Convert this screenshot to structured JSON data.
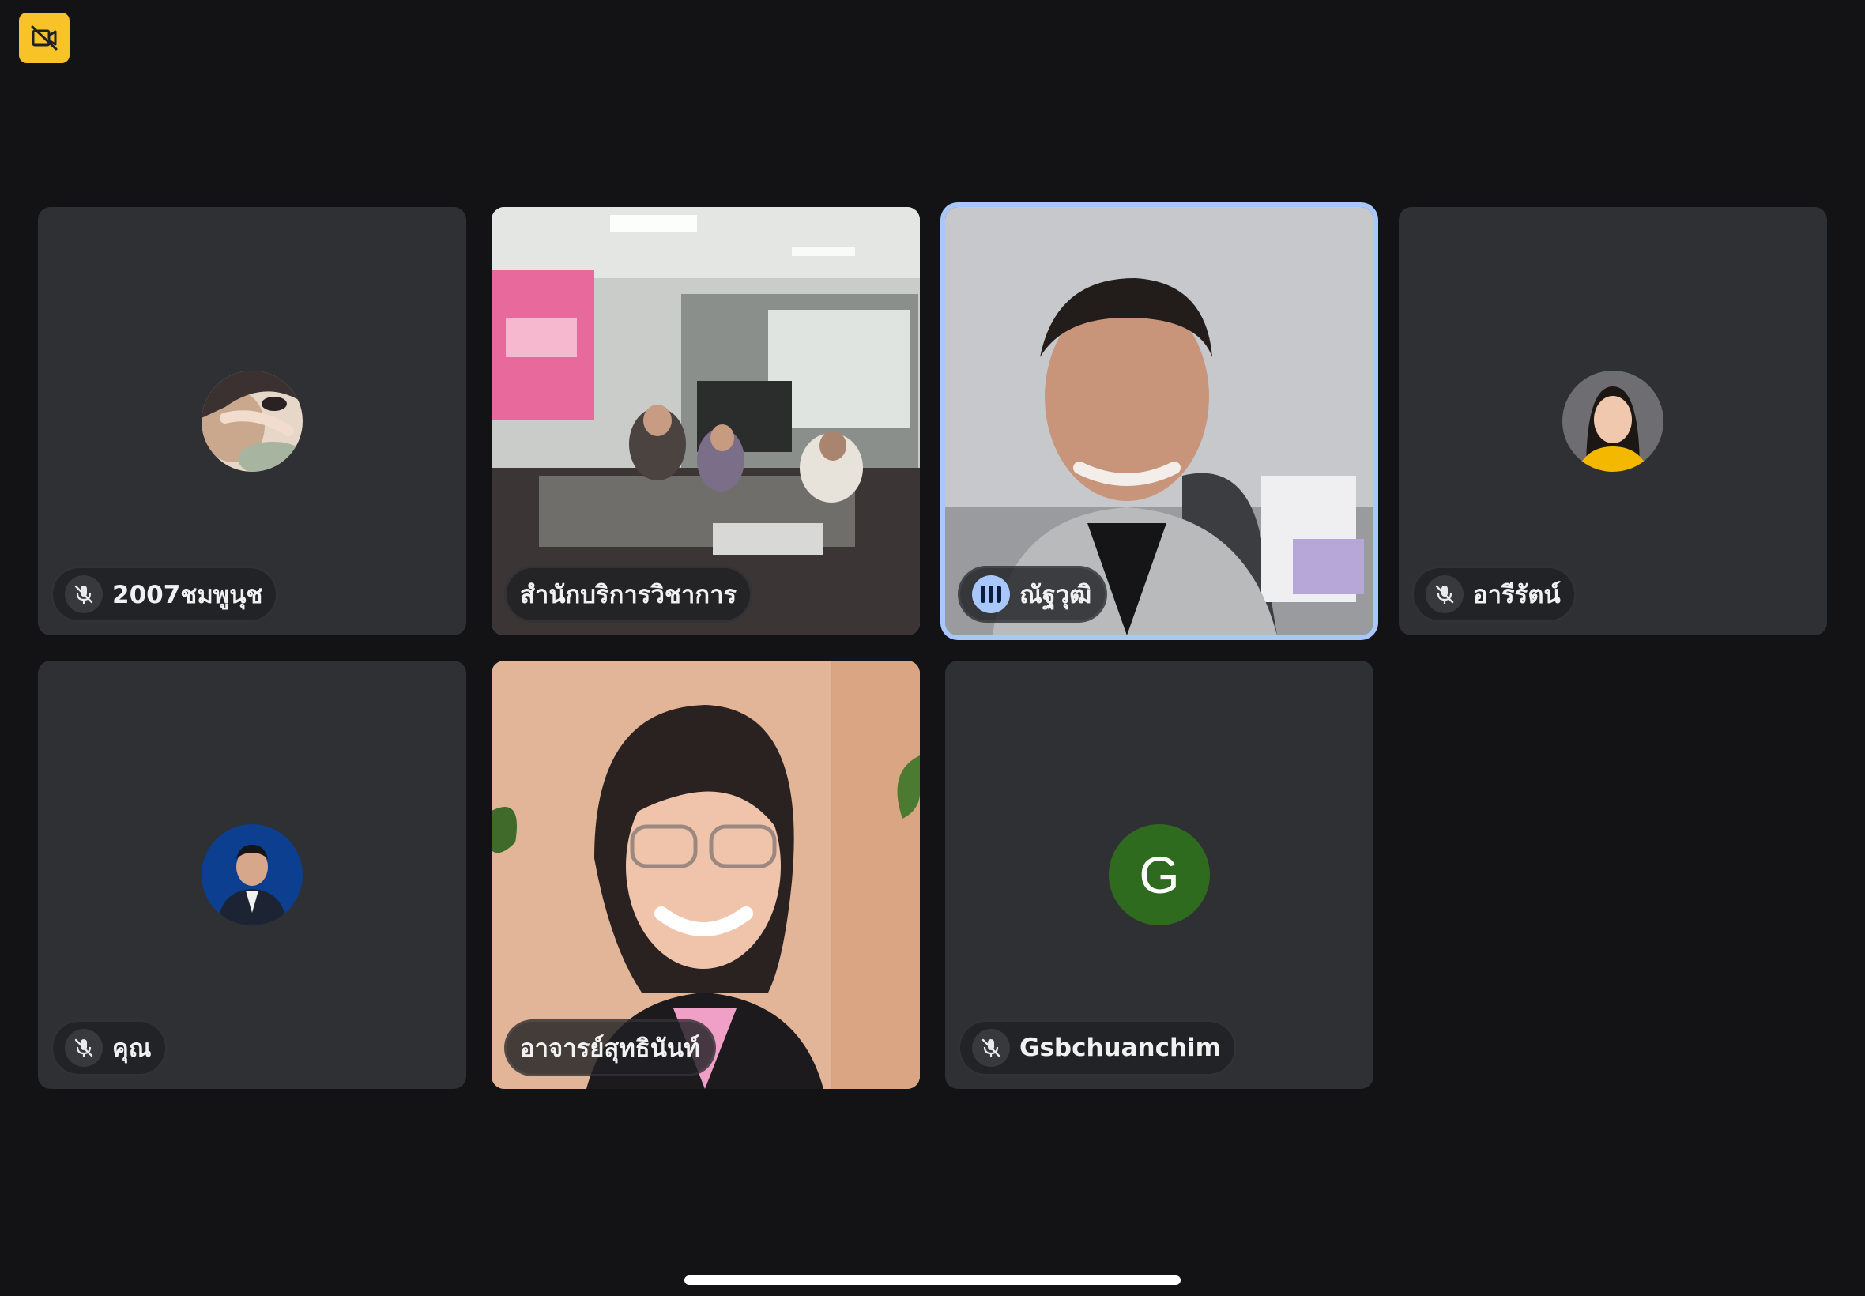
{
  "toolbar": {
    "camera_off_icon": "video-off-icon",
    "camera_off_color": "#f7c328"
  },
  "participants": [
    {
      "name": "2007ชมพูนุช",
      "muted": true,
      "avatar": "photo"
    },
    {
      "name": "สำนักบริการวิชาการ",
      "video": "meeting-room"
    },
    {
      "name": "ณัฐวุฒิ",
      "speaking": true,
      "video": "man-smiling"
    },
    {
      "name": "อารีรัตน์",
      "muted": true,
      "avatar": "photo"
    },
    {
      "name": "คุณ",
      "muted": true,
      "avatar": "photo"
    },
    {
      "name": "อาจารย์สุทธินันท์",
      "video": "woman-smiling"
    },
    {
      "name": "Gsbchuanchim",
      "muted": true,
      "avatar_letter": "G",
      "avatar_color": "#2e6b1e"
    }
  ],
  "colors": {
    "background": "#131316",
    "tile": "#2f3033",
    "speaking_border": "#a8c7fa"
  }
}
